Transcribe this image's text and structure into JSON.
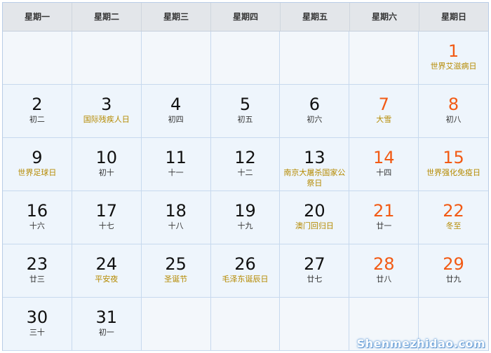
{
  "weekdays": [
    "星期一",
    "星期二",
    "星期三",
    "星期四",
    "星期五",
    "星期六",
    "星期日"
  ],
  "weekend_color": "#f25a14",
  "holiday_color": "#b58a00",
  "cells": [
    {
      "day": "",
      "note": "",
      "weekend": false,
      "holiday": false
    },
    {
      "day": "",
      "note": "",
      "weekend": false,
      "holiday": false
    },
    {
      "day": "",
      "note": "",
      "weekend": false,
      "holiday": false
    },
    {
      "day": "",
      "note": "",
      "weekend": false,
      "holiday": false
    },
    {
      "day": "",
      "note": "",
      "weekend": false,
      "holiday": false
    },
    {
      "day": "",
      "note": "",
      "weekend": false,
      "holiday": false
    },
    {
      "day": "1",
      "note": "世界艾滋病日",
      "weekend": true,
      "holiday": true
    },
    {
      "day": "2",
      "note": "初二",
      "weekend": false,
      "holiday": false
    },
    {
      "day": "3",
      "note": "国际残疾人日",
      "weekend": false,
      "holiday": true
    },
    {
      "day": "4",
      "note": "初四",
      "weekend": false,
      "holiday": false
    },
    {
      "day": "5",
      "note": "初五",
      "weekend": false,
      "holiday": false
    },
    {
      "day": "6",
      "note": "初六",
      "weekend": false,
      "holiday": false
    },
    {
      "day": "7",
      "note": "大雪",
      "weekend": true,
      "holiday": true
    },
    {
      "day": "8",
      "note": "初八",
      "weekend": true,
      "holiday": false
    },
    {
      "day": "9",
      "note": "世界足球日",
      "weekend": false,
      "holiday": true
    },
    {
      "day": "10",
      "note": "初十",
      "weekend": false,
      "holiday": false
    },
    {
      "day": "11",
      "note": "十一",
      "weekend": false,
      "holiday": false
    },
    {
      "day": "12",
      "note": "十二",
      "weekend": false,
      "holiday": false
    },
    {
      "day": "13",
      "note": "南京大屠杀国家公祭日",
      "weekend": false,
      "holiday": true
    },
    {
      "day": "14",
      "note": "十四",
      "weekend": true,
      "holiday": false
    },
    {
      "day": "15",
      "note": "世界强化免疫日",
      "weekend": true,
      "holiday": true
    },
    {
      "day": "16",
      "note": "十六",
      "weekend": false,
      "holiday": false
    },
    {
      "day": "17",
      "note": "十七",
      "weekend": false,
      "holiday": false
    },
    {
      "day": "18",
      "note": "十八",
      "weekend": false,
      "holiday": false
    },
    {
      "day": "19",
      "note": "十九",
      "weekend": false,
      "holiday": false
    },
    {
      "day": "20",
      "note": "澳门回归日",
      "weekend": false,
      "holiday": true
    },
    {
      "day": "21",
      "note": "廿一",
      "weekend": true,
      "holiday": false
    },
    {
      "day": "22",
      "note": "冬至",
      "weekend": true,
      "holiday": true
    },
    {
      "day": "23",
      "note": "廿三",
      "weekend": false,
      "holiday": false
    },
    {
      "day": "24",
      "note": "平安夜",
      "weekend": false,
      "holiday": true
    },
    {
      "day": "25",
      "note": "圣诞节",
      "weekend": false,
      "holiday": true
    },
    {
      "day": "26",
      "note": "毛泽东诞辰日",
      "weekend": false,
      "holiday": true
    },
    {
      "day": "27",
      "note": "廿七",
      "weekend": false,
      "holiday": false
    },
    {
      "day": "28",
      "note": "廿八",
      "weekend": true,
      "holiday": false
    },
    {
      "day": "29",
      "note": "廿九",
      "weekend": true,
      "holiday": false
    },
    {
      "day": "30",
      "note": "三十",
      "weekend": false,
      "holiday": false
    },
    {
      "day": "31",
      "note": "初一",
      "weekend": false,
      "holiday": false
    },
    {
      "day": "",
      "note": "",
      "weekend": false,
      "holiday": false
    },
    {
      "day": "",
      "note": "",
      "weekend": false,
      "holiday": false
    },
    {
      "day": "",
      "note": "",
      "weekend": false,
      "holiday": false
    },
    {
      "day": "",
      "note": "",
      "weekend": false,
      "holiday": false
    },
    {
      "day": "",
      "note": "",
      "weekend": false,
      "holiday": false
    }
  ],
  "watermark": "Shenmezhidao.com"
}
